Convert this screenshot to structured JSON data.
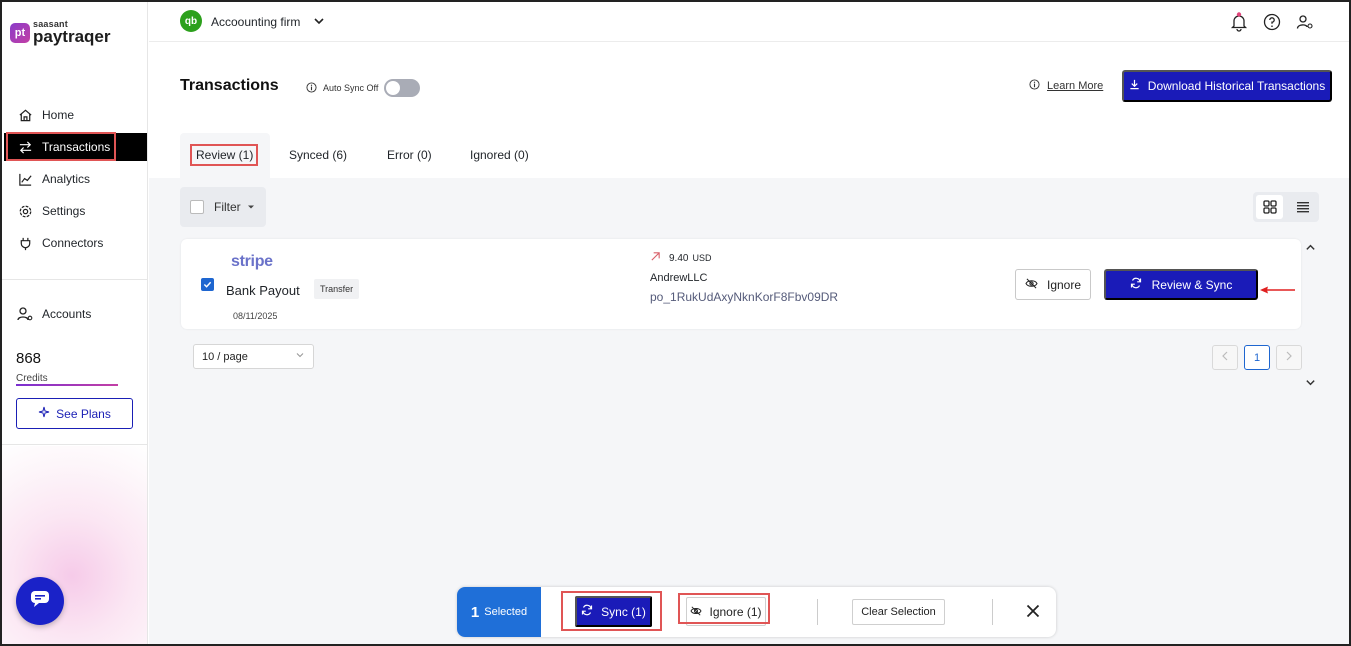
{
  "brand": {
    "small": "saasant",
    "name": "paytraqer",
    "mark": "pt"
  },
  "sidebar": {
    "items": [
      {
        "label": "Home"
      },
      {
        "label": "Transactions"
      },
      {
        "label": "Analytics"
      },
      {
        "label": "Settings"
      },
      {
        "label": "Connectors"
      },
      {
        "label": "Accounts"
      }
    ],
    "credits_value": "868",
    "credits_label": "Credits",
    "see_plans_label": "See Plans"
  },
  "header": {
    "qb_mark": "qb",
    "company": "Accoounting firm"
  },
  "page": {
    "title": "Transactions",
    "auto_sync_label": "Auto Sync Off",
    "learn_more": "Learn More",
    "download_label": "Download Historical Transactions"
  },
  "tabs": [
    {
      "label": "Review (1)"
    },
    {
      "label": "Synced (6)"
    },
    {
      "label": "Error (0)"
    },
    {
      "label": "Ignored (0)"
    }
  ],
  "filter_label": "Filter",
  "transaction": {
    "source": "stripe",
    "type": "Bank Payout",
    "badge": "Transfer",
    "date": "08/11/2025",
    "amount": "9.40",
    "currency": "USD",
    "merchant": "AndrewLLC",
    "payout_id": "po_1RukUdAxyNknKorF8Fbv09DR",
    "ignore_label": "Ignore",
    "review_sync_label": "Review & Sync"
  },
  "pagination": {
    "per_page": "10 / page",
    "current_page": "1"
  },
  "bulk_bar": {
    "count": "1",
    "selected_label": "Selected",
    "sync_label": "Sync (1)",
    "ignore_label": "Ignore (1)",
    "clear_label": "Clear Selection"
  },
  "colors": {
    "primary": "#1a1bb8",
    "accent_blue": "#1f6fd8",
    "qb_green": "#2ca01c",
    "highlight_red": "#e05555"
  }
}
